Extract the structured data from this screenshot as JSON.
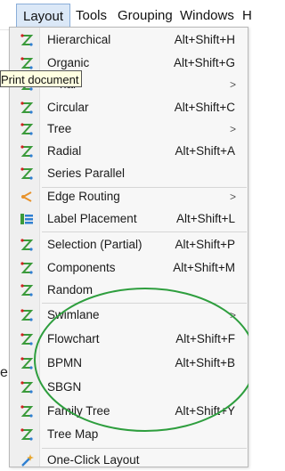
{
  "menubar": {
    "items": [
      {
        "label": "Layout",
        "active": true
      },
      {
        "label": "Tools"
      },
      {
        "label": "Grouping"
      },
      {
        "label": "Windows"
      },
      {
        "label": "H"
      }
    ]
  },
  "tooltip": "Print document",
  "cut_text": "e",
  "menu": {
    "items": [
      {
        "label": "Hierarchical",
        "shortcut": "Alt+Shift+H",
        "icon": "layout-icon"
      },
      {
        "label": "Organic",
        "shortcut": "Alt+Shift+G",
        "icon": "layout-icon"
      },
      {
        "label": "Orthogonal",
        "visible_label": "nal",
        "submenu": ">",
        "icon": "layout-icon"
      },
      {
        "label": "Circular",
        "shortcut": "Alt+Shift+C",
        "icon": "layout-icon"
      },
      {
        "label": "Tree",
        "submenu": ">",
        "icon": "layout-icon"
      },
      {
        "label": "Radial",
        "shortcut": "Alt+Shift+A",
        "icon": "layout-icon"
      },
      {
        "label": "Series Parallel",
        "icon": "layout-icon"
      },
      {
        "label": "Edge Routing",
        "submenu": ">",
        "icon": "edge-routing-icon"
      },
      {
        "label": "Label Placement",
        "shortcut": "Alt+Shift+L",
        "icon": "label-placement-icon"
      },
      {
        "label": "Selection (Partial)",
        "shortcut": "Alt+Shift+P",
        "icon": "layout-icon"
      },
      {
        "label": "Components",
        "shortcut": "Alt+Shift+M",
        "icon": "layout-icon"
      },
      {
        "label": "Random",
        "icon": "layout-icon"
      },
      {
        "label": "Swimlane",
        "submenu": ">",
        "icon": "layout-icon"
      },
      {
        "label": "Flowchart",
        "shortcut": "Alt+Shift+F",
        "icon": "layout-icon"
      },
      {
        "label": "BPMN",
        "shortcut": "Alt+Shift+B",
        "icon": "layout-icon"
      },
      {
        "label": "SBGN",
        "icon": "layout-icon"
      },
      {
        "label": "Family Tree",
        "shortcut": "Alt+Shift+Y",
        "icon": "layout-icon"
      },
      {
        "label": "Tree Map",
        "icon": "layout-icon"
      },
      {
        "label": "One-Click Layout",
        "icon": "wand-icon"
      }
    ]
  },
  "colors": {
    "icon_green": "#3a9a3a",
    "icon_red": "#d02020",
    "icon_orange": "#e8922a",
    "icon_blue": "#2f7fd1",
    "highlight_circle": "#2e9e3e"
  }
}
